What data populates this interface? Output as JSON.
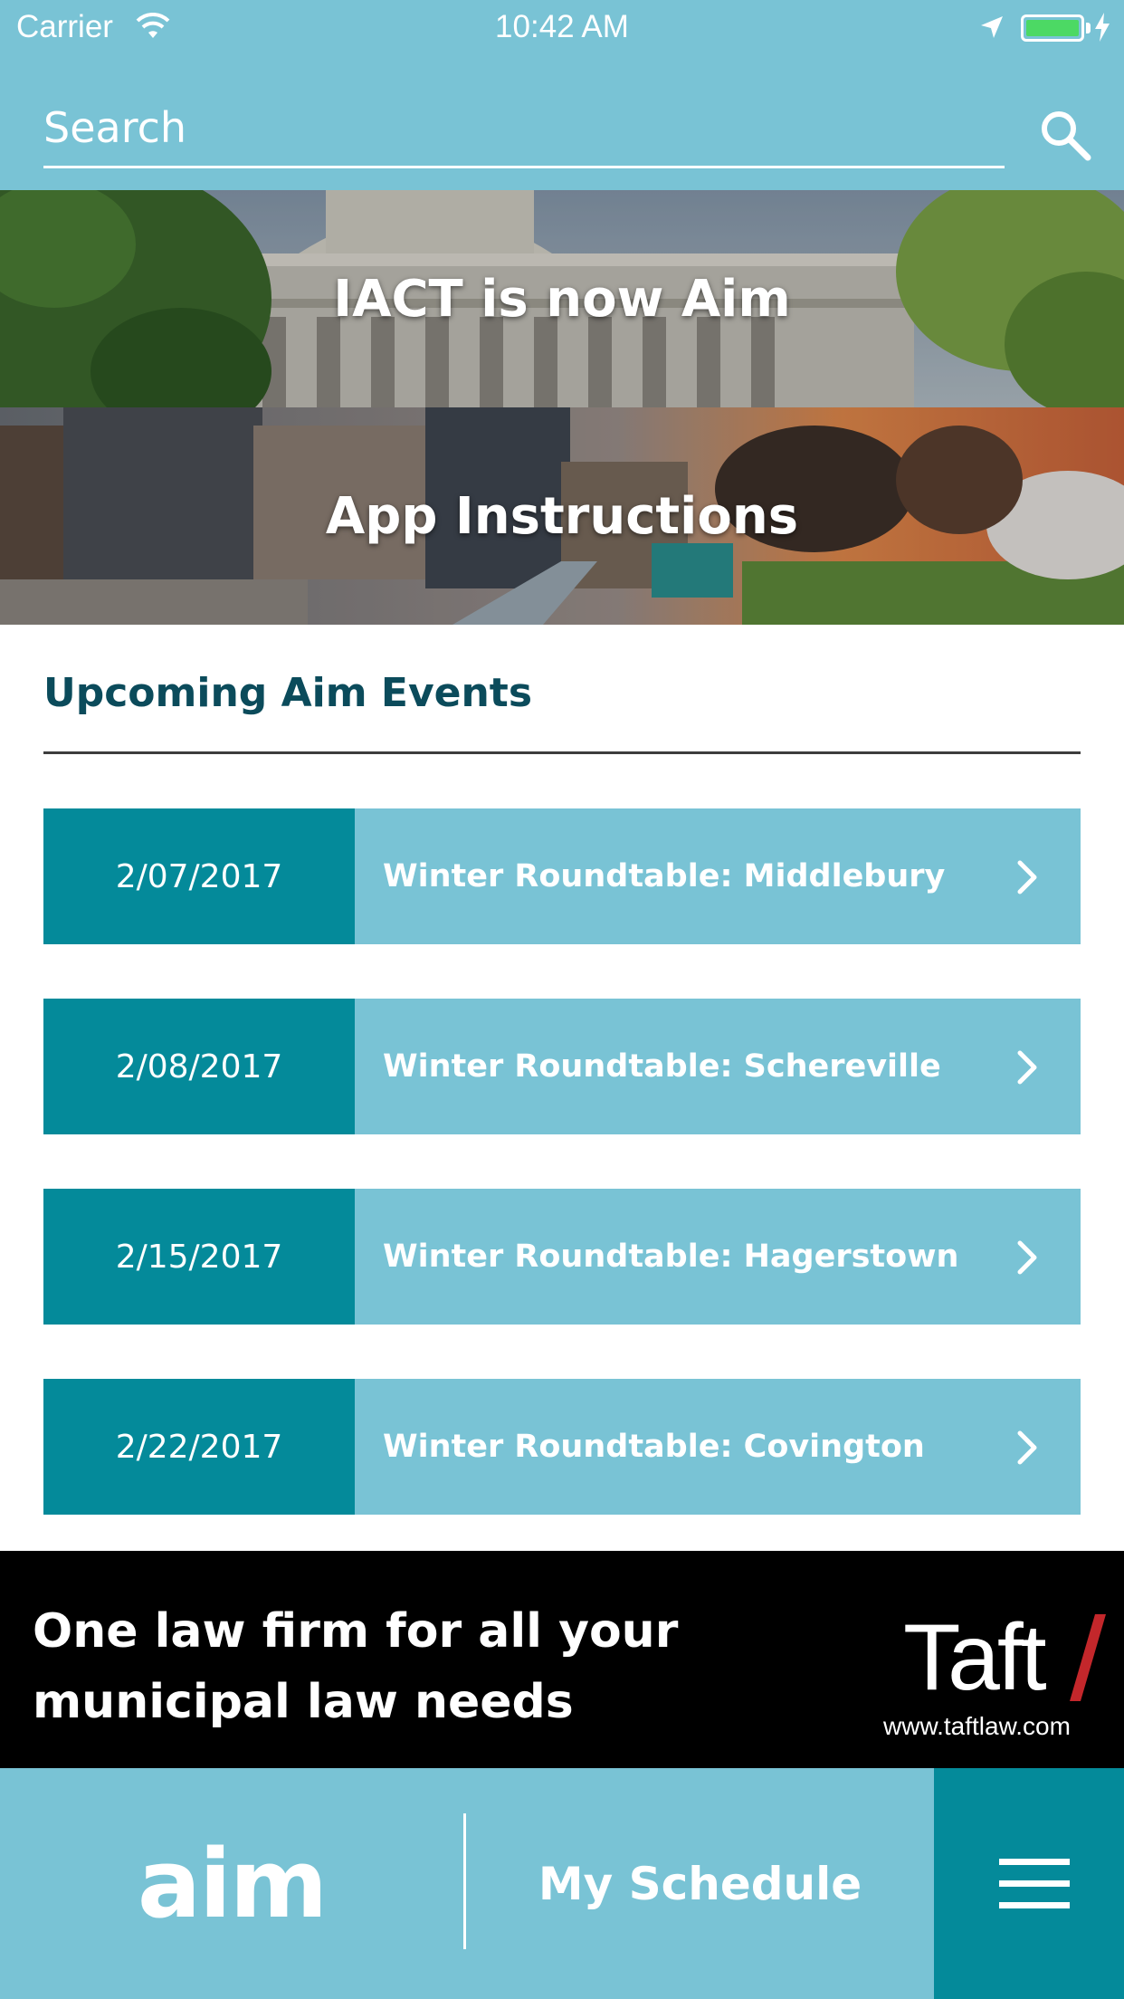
{
  "status_bar": {
    "carrier": "Carrier",
    "time": "10:42 AM"
  },
  "search": {
    "placeholder": "Search"
  },
  "banners": [
    {
      "title": "IACT is now Aim"
    },
    {
      "title": "App Instructions"
    }
  ],
  "events_section": {
    "title": "Upcoming Aim Events",
    "events": [
      {
        "date": "2/07/2017",
        "title": "Winter Roundtable: Middlebury"
      },
      {
        "date": "2/08/2017",
        "title": "Winter Roundtable: Schereville"
      },
      {
        "date": "2/15/2017",
        "title": "Winter Roundtable: Hagerstown"
      },
      {
        "date": "2/22/2017",
        "title": "Winter Roundtable: Covington"
      }
    ]
  },
  "ad": {
    "line1": "One law firm for all your",
    "line2": "municipal law needs",
    "logo": "Taft",
    "url": "www.taftlaw.com"
  },
  "bottom_bar": {
    "logo": "aim",
    "schedule_label": "My Schedule"
  },
  "colors": {
    "header": "#79c3d5",
    "dark_teal": "#048a9a",
    "section_title": "#0b4b5b",
    "ad_slash": "#c3272b",
    "battery": "#4cd964"
  },
  "icons": {
    "wifi": "wifi-icon",
    "location": "location-arrow-icon",
    "battery": "battery-icon",
    "charging": "charging-bolt-icon",
    "search": "search-icon",
    "chevron": "chevron-right-icon",
    "menu": "hamburger-menu-icon"
  }
}
